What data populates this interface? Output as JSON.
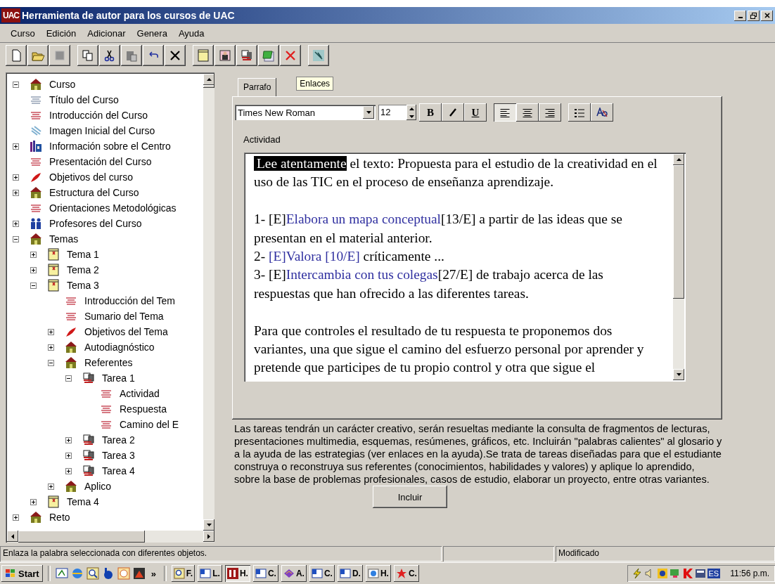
{
  "window": {
    "logo": "UAC",
    "title": "Herramienta de autor para los cursos de UAC"
  },
  "menu": [
    "Curso",
    "Edición",
    "Adicionar",
    "Genera",
    "Ayuda"
  ],
  "tree": [
    {
      "label": "Curso",
      "kind": "module",
      "expanded": true,
      "children": [
        {
          "label": "Título del Curso",
          "kind": "heading"
        },
        {
          "label": "Introducción del Curso",
          "kind": "text"
        },
        {
          "label": "Imagen Inicial del Curso",
          "kind": "media"
        },
        {
          "label": "Información sobre el Centro",
          "kind": "centre",
          "expanded": false
        },
        {
          "label": "Presentación del Curso",
          "kind": "text"
        },
        {
          "label": "Objetivos del curso",
          "kind": "goals",
          "expanded": false
        },
        {
          "label": "Estructura del Curso",
          "kind": "module",
          "expanded": false
        },
        {
          "label": "Orientaciones Metodológicas",
          "kind": "text"
        },
        {
          "label": "Profesores del Curso",
          "kind": "staff",
          "expanded": false
        },
        {
          "label": "Temas",
          "kind": "module",
          "expanded": true,
          "children": [
            {
              "label": "Tema 1",
              "kind": "topic",
              "expanded": false
            },
            {
              "label": "Tema 2",
              "kind": "topic",
              "expanded": false
            },
            {
              "label": "Tema 3",
              "kind": "topic",
              "expanded": true,
              "children": [
                {
                  "label": "Introducción del Tem",
                  "kind": "text"
                },
                {
                  "label": "Sumario del Tema",
                  "kind": "text"
                },
                {
                  "label": "Objetivos del Tema",
                  "kind": "goals",
                  "expanded": false
                },
                {
                  "label": "Autodiagnóstico",
                  "kind": "module",
                  "expanded": false
                },
                {
                  "label": "Referentes",
                  "kind": "module",
                  "expanded": true,
                  "children": [
                    {
                      "label": "Tarea 1",
                      "kind": "task",
                      "expanded": true,
                      "children": [
                        {
                          "label": "Actividad",
                          "kind": "text"
                        },
                        {
                          "label": "Respuesta",
                          "kind": "text"
                        },
                        {
                          "label": "Camino del E",
                          "kind": "text"
                        }
                      ]
                    },
                    {
                      "label": "Tarea 2",
                      "kind": "task",
                      "expanded": false
                    },
                    {
                      "label": "Tarea 3",
                      "kind": "task",
                      "expanded": false
                    },
                    {
                      "label": "Tarea 4",
                      "kind": "task",
                      "expanded": false
                    }
                  ]
                },
                {
                  "label": "Aplico",
                  "kind": "module",
                  "expanded": false
                }
              ]
            },
            {
              "label": "Tema 4",
              "kind": "topic",
              "expanded": false
            }
          ]
        },
        {
          "label": "Reto",
          "kind": "module",
          "expanded": false
        }
      ]
    }
  ],
  "tabs": [
    {
      "label": "Parrafo",
      "selected": true
    },
    {
      "label": "Enlaces",
      "selected": false
    }
  ],
  "format_bar": {
    "font": "Times New Roman",
    "size": "12",
    "buttons": [
      {
        "kind": "bold",
        "label": "B"
      },
      {
        "kind": "italic"
      },
      {
        "kind": "underline",
        "label": "U"
      },
      {
        "kind": "align-left",
        "selected": true
      },
      {
        "kind": "align-center",
        "selected": false
      },
      {
        "kind": "align-right",
        "selected": false
      },
      {
        "kind": "list"
      },
      {
        "kind": "spelling"
      }
    ]
  },
  "section_label": "Actividad",
  "editor": [
    [
      [
        {
          "text": "Lee atentamente",
          "kind": "selected"
        },
        {
          "text": " el texto: Propuesta para el estudio de la creatividad en el uso de las TIC en el proceso de enseñanza aprendizaje.",
          "kind": "plain"
        }
      ]
    ],
    [
      [
        {
          "text": "1- [E]",
          "kind": "plain"
        },
        {
          "text": "Elabora un mapa conceptual",
          "kind": "link"
        },
        {
          "text": "[13/E] a partir de las ideas que se presentan en el material anterior.",
          "kind": "plain"
        }
      ],
      [
        {
          "text": "2- ",
          "kind": "plain"
        },
        {
          "text": "[E]Valora [10/E]",
          "kind": "link"
        },
        {
          "text": " críticamente ...",
          "kind": "plain"
        }
      ],
      [
        {
          "text": "3- [E]",
          "kind": "plain"
        },
        {
          "text": "Intercambia con tus colegas",
          "kind": "link"
        },
        {
          "text": "[27/E] de trabajo acerca de las respuestas que han ofrecido a las diferentes tareas.",
          "kind": "plain"
        }
      ]
    ],
    [
      [
        {
          "text": "Para que controles el resultado de tu respuesta te proponemos dos variantes, una que sigue el camino del esfuerzo personal por aprender y pretende que participes de tu propio control y otra que sigue el",
          "kind": "plain"
        }
      ]
    ]
  ],
  "description": "Las tareas tendrán un carácter creativo, serán resueltas mediante la consulta de fragmentos de lecturas, presentaciones multimedia, esquemas, resúmenes, gráficos, etc. Incluirán \"palabras calientes\" al glosario y a la ayuda de las estrategias (ver enlaces en la ayuda).Se trata de tareas diseñadas para que el estudiante construya o reconstruya sus referentes (conocimientos, habilidades y valores) y aplique lo aprendido, sobre la base de problemas profesionales, casos de estudio, elaborar un proyecto, entre otras variantes.",
  "include_button": "Incluir",
  "status_bar": [
    "Enlaza la palabra seleccionada con diferentes objetos.",
    "Modificado"
  ],
  "taskbar": {
    "start": "Start",
    "more": "»",
    "tasks": [
      {
        "label": "F.",
        "selected": false
      },
      {
        "label": "L.",
        "selected": false
      },
      {
        "label": "H.",
        "selected": true
      },
      {
        "label": "C.",
        "selected": false
      },
      {
        "label": "A.",
        "selected": false
      },
      {
        "label": "C.",
        "selected": false
      },
      {
        "label": "D.",
        "selected": false
      },
      {
        "label": "H.",
        "selected": false
      },
      {
        "label": "C.",
        "selected": false
      }
    ],
    "language": "ES",
    "clock": "11:56 p.m."
  }
}
